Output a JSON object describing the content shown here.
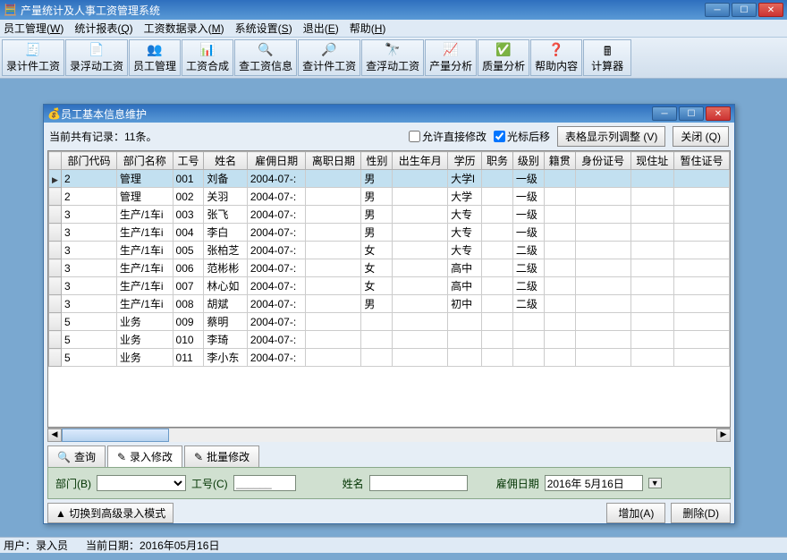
{
  "window": {
    "title": "产量统计及人事工资管理系统"
  },
  "menu": [
    {
      "label": "员工管理",
      "key": "W"
    },
    {
      "label": "统计报表",
      "key": "Q"
    },
    {
      "label": "工资数据录入",
      "key": "M"
    },
    {
      "label": "系统设置",
      "key": "S"
    },
    {
      "label": "退出",
      "key": "E"
    },
    {
      "label": "帮助",
      "key": "H"
    }
  ],
  "toolbar": [
    "录计件工资",
    "录浮动工资",
    "员工管理",
    "工资合成",
    "查工资信息",
    "查计件工资",
    "查浮动工资",
    "产量分析",
    "质量分析",
    "帮助内容",
    "计算器"
  ],
  "subwin": {
    "title": "员工基本信息维护",
    "record_info": "当前共有记录：11条。",
    "chk_direct_edit": "允许直接修改",
    "chk_cursor_after": "光标后移",
    "btn_colset": "表格显示列调整 (V)",
    "btn_close": "关闭 (Q)"
  },
  "columns": [
    "部门代码",
    "部门名称",
    "工号",
    "姓名",
    "雇佣日期",
    "离职日期",
    "性别",
    "出生年月",
    "学历",
    "职务",
    "级别",
    "籍贯",
    "身份证号",
    "现住址",
    "暂住证号"
  ],
  "rows": [
    {
      "dept": "2",
      "dname": "管理",
      "no": "001",
      "name": "刘备",
      "hire": "2004-07-:",
      "leave": "",
      "sex": "男",
      "birth": "",
      "edu": "大学l",
      "pos": "",
      "rank": "一级"
    },
    {
      "dept": "2",
      "dname": "管理",
      "no": "002",
      "name": "关羽",
      "hire": "2004-07-:",
      "leave": "",
      "sex": "男",
      "birth": "",
      "edu": "大学",
      "pos": "",
      "rank": "一级"
    },
    {
      "dept": "3",
      "dname": "生产/1车i",
      "no": "003",
      "name": "张飞",
      "hire": "2004-07-:",
      "leave": "",
      "sex": "男",
      "birth": "",
      "edu": "大专",
      "pos": "",
      "rank": "一级"
    },
    {
      "dept": "3",
      "dname": "生产/1车i",
      "no": "004",
      "name": "李白",
      "hire": "2004-07-:",
      "leave": "",
      "sex": "男",
      "birth": "",
      "edu": "大专",
      "pos": "",
      "rank": "一级"
    },
    {
      "dept": "3",
      "dname": "生产/1车i",
      "no": "005",
      "name": "张柏芝",
      "hire": "2004-07-:",
      "leave": "",
      "sex": "女",
      "birth": "",
      "edu": "大专",
      "pos": "",
      "rank": "二级"
    },
    {
      "dept": "3",
      "dname": "生产/1车i",
      "no": "006",
      "name": "范彬彬",
      "hire": "2004-07-:",
      "leave": "",
      "sex": "女",
      "birth": "",
      "edu": "高中",
      "pos": "",
      "rank": "二级"
    },
    {
      "dept": "3",
      "dname": "生产/1车i",
      "no": "007",
      "name": "林心如",
      "hire": "2004-07-:",
      "leave": "",
      "sex": "女",
      "birth": "",
      "edu": "高中",
      "pos": "",
      "rank": "二级"
    },
    {
      "dept": "3",
      "dname": "生产/1车i",
      "no": "008",
      "name": "胡斌",
      "hire": "2004-07-:",
      "leave": "",
      "sex": "男",
      "birth": "",
      "edu": "初中",
      "pos": "",
      "rank": "二级"
    },
    {
      "dept": "5",
      "dname": "业务",
      "no": "009",
      "name": "蔡明",
      "hire": "2004-07-:",
      "leave": "",
      "sex": "",
      "birth": "",
      "edu": "",
      "pos": "",
      "rank": ""
    },
    {
      "dept": "5",
      "dname": "业务",
      "no": "010",
      "name": "李琦",
      "hire": "2004-07-:",
      "leave": "",
      "sex": "",
      "birth": "",
      "edu": "",
      "pos": "",
      "rank": ""
    },
    {
      "dept": "5",
      "dname": "业务",
      "no": "011",
      "name": "李小东",
      "hire": "2004-07-:",
      "leave": "",
      "sex": "",
      "birth": "",
      "edu": "",
      "pos": "",
      "rank": ""
    }
  ],
  "tabs": [
    {
      "label": "查询",
      "icon": "🔍"
    },
    {
      "label": "录入修改",
      "icon": "✎"
    },
    {
      "label": "批量修改",
      "icon": "✎"
    }
  ],
  "active_tab": 1,
  "form": {
    "dept_label": "部门(B)",
    "no_label": "工号(C)",
    "no_placeholder": "______",
    "name_label": "姓名",
    "hire_label": "雇佣日期",
    "hire_value": "2016年 5月16日"
  },
  "toggle_btn": "切换到高级录入模式",
  "btn_add": "增加(A)",
  "btn_del": "删除(D)",
  "status": {
    "user_label": "用户：",
    "user": "录入员",
    "date_label": "当前日期：",
    "date": "2016年05月16日"
  }
}
